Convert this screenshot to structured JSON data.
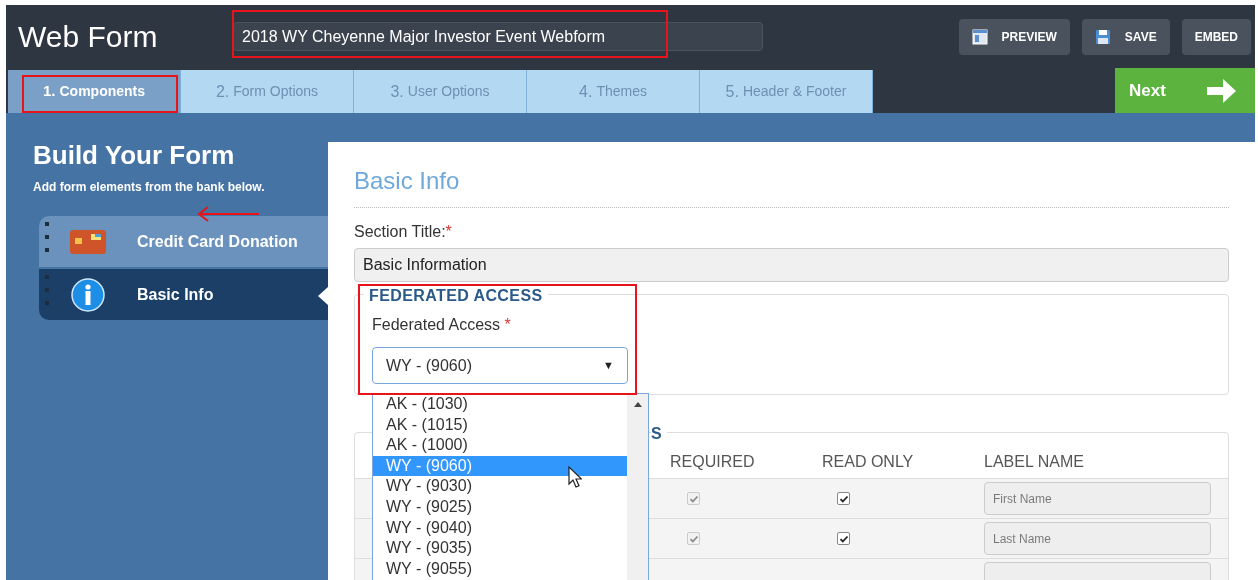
{
  "header": {
    "title": "Web Form",
    "form_name": "2018 WY Cheyenne Major Investor Event Webform",
    "buttons": [
      {
        "kind": "preview",
        "label": "PREVIEW"
      },
      {
        "kind": "save",
        "label": "SAVE"
      },
      {
        "kind": "embed",
        "label": "EMBED"
      }
    ]
  },
  "steps": [
    {
      "number": "1.",
      "label": "Components",
      "selected": true
    },
    {
      "number": "2.",
      "label": "Form Options",
      "selected": false
    },
    {
      "number": "3.",
      "label": "User Options",
      "selected": false
    },
    {
      "number": "4.",
      "label": "Themes",
      "selected": false
    },
    {
      "number": "5.",
      "label": "Header & Footer",
      "selected": false
    }
  ],
  "next_button": "Next",
  "sidebar": {
    "title": "Build Your Form",
    "subtitle": "Add form elements from the bank below.",
    "items": [
      {
        "kind": "card",
        "label": "Credit Card Donation",
        "selected": false
      },
      {
        "kind": "info",
        "label": "Basic Info",
        "selected": true
      }
    ]
  },
  "panel": {
    "heading": "Basic Info",
    "section_title_label": "Section Title:",
    "required_mark": "*",
    "section_title_value": "Basic Information",
    "federated": {
      "legend": "FEDERATED ACCESS",
      "label": "Federated Access",
      "required_mark": "*",
      "value": "WY - (9060)",
      "caret": "▼",
      "options": [
        {
          "label": "AK - (1030)",
          "selected": false
        },
        {
          "label": "AK - (1015)",
          "selected": false
        },
        {
          "label": "AK - (1000)",
          "selected": false
        },
        {
          "label": "WY - (9060)",
          "selected": true
        },
        {
          "label": "WY - (9030)",
          "selected": false
        },
        {
          "label": "WY - (9025)",
          "selected": false
        },
        {
          "label": "WY - (9040)",
          "selected": false
        },
        {
          "label": "WY - (9035)",
          "selected": false
        },
        {
          "label": "WY - (9055)",
          "selected": false
        }
      ]
    },
    "fields": {
      "legend_end": "S",
      "columns": [
        "REQUIRED",
        "READ ONLY",
        "LABEL NAME"
      ],
      "rows": [
        {
          "required": true,
          "required_disabled": true,
          "read_only": true,
          "label_placeholder": "First Name"
        },
        {
          "required": true,
          "required_disabled": true,
          "read_only": true,
          "label_placeholder": "Last Name"
        }
      ]
    }
  }
}
